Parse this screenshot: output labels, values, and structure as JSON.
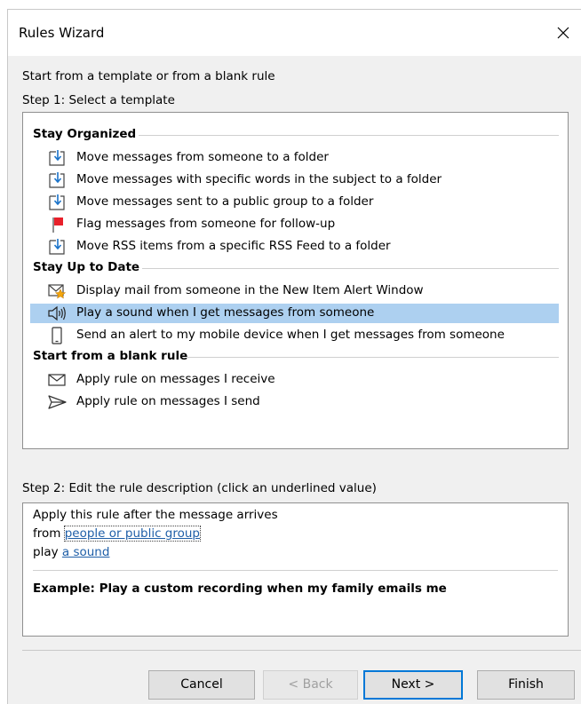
{
  "window": {
    "title": "Rules Wizard",
    "close_icon": "close-icon"
  },
  "intro": "Start from a template or from a blank rule",
  "step1": "Step 1: Select a template",
  "sections": [
    {
      "title": "Stay Organized",
      "items": [
        {
          "label": "Move messages from someone to a folder",
          "icon": "move-to-folder-icon"
        },
        {
          "label": "Move messages with specific words in the subject to a folder",
          "icon": "move-to-folder-icon"
        },
        {
          "label": "Move messages sent to a public group to a folder",
          "icon": "move-to-folder-icon"
        },
        {
          "label": "Flag messages from someone for follow-up",
          "icon": "red-flag-icon"
        },
        {
          "label": "Move RSS items from a specific RSS Feed to a folder",
          "icon": "move-to-folder-icon"
        }
      ]
    },
    {
      "title": "Stay Up to Date",
      "items": [
        {
          "label": "Display mail from someone in the New Item Alert Window",
          "icon": "new-item-alert-icon"
        },
        {
          "label": "Play a sound when I get messages from someone",
          "icon": "speaker-icon",
          "selected": true
        },
        {
          "label": "Send an alert to my mobile device when I get messages from someone",
          "icon": "mobile-device-icon"
        }
      ]
    },
    {
      "title": "Start from a blank rule",
      "items": [
        {
          "label": "Apply rule on messages I receive",
          "icon": "envelope-icon"
        },
        {
          "label": "Apply rule on messages I send",
          "icon": "send-arrow-icon"
        }
      ]
    }
  ],
  "step2": "Step 2: Edit the rule description (click an underlined value)",
  "description": {
    "line1": "Apply this rule after the message arrives",
    "line2_prefix": "from",
    "line2_link": "people or public group",
    "line3_prefix": "play",
    "line3_link": "a sound",
    "example": "Example: Play a custom recording when my family emails me"
  },
  "buttons": {
    "cancel": "Cancel",
    "back": "< Back",
    "next": "Next >",
    "finish": "Finish"
  },
  "colors": {
    "selection": "#add0f0",
    "link": "#1f5fa8",
    "default_button_border": "#0078d7"
  }
}
